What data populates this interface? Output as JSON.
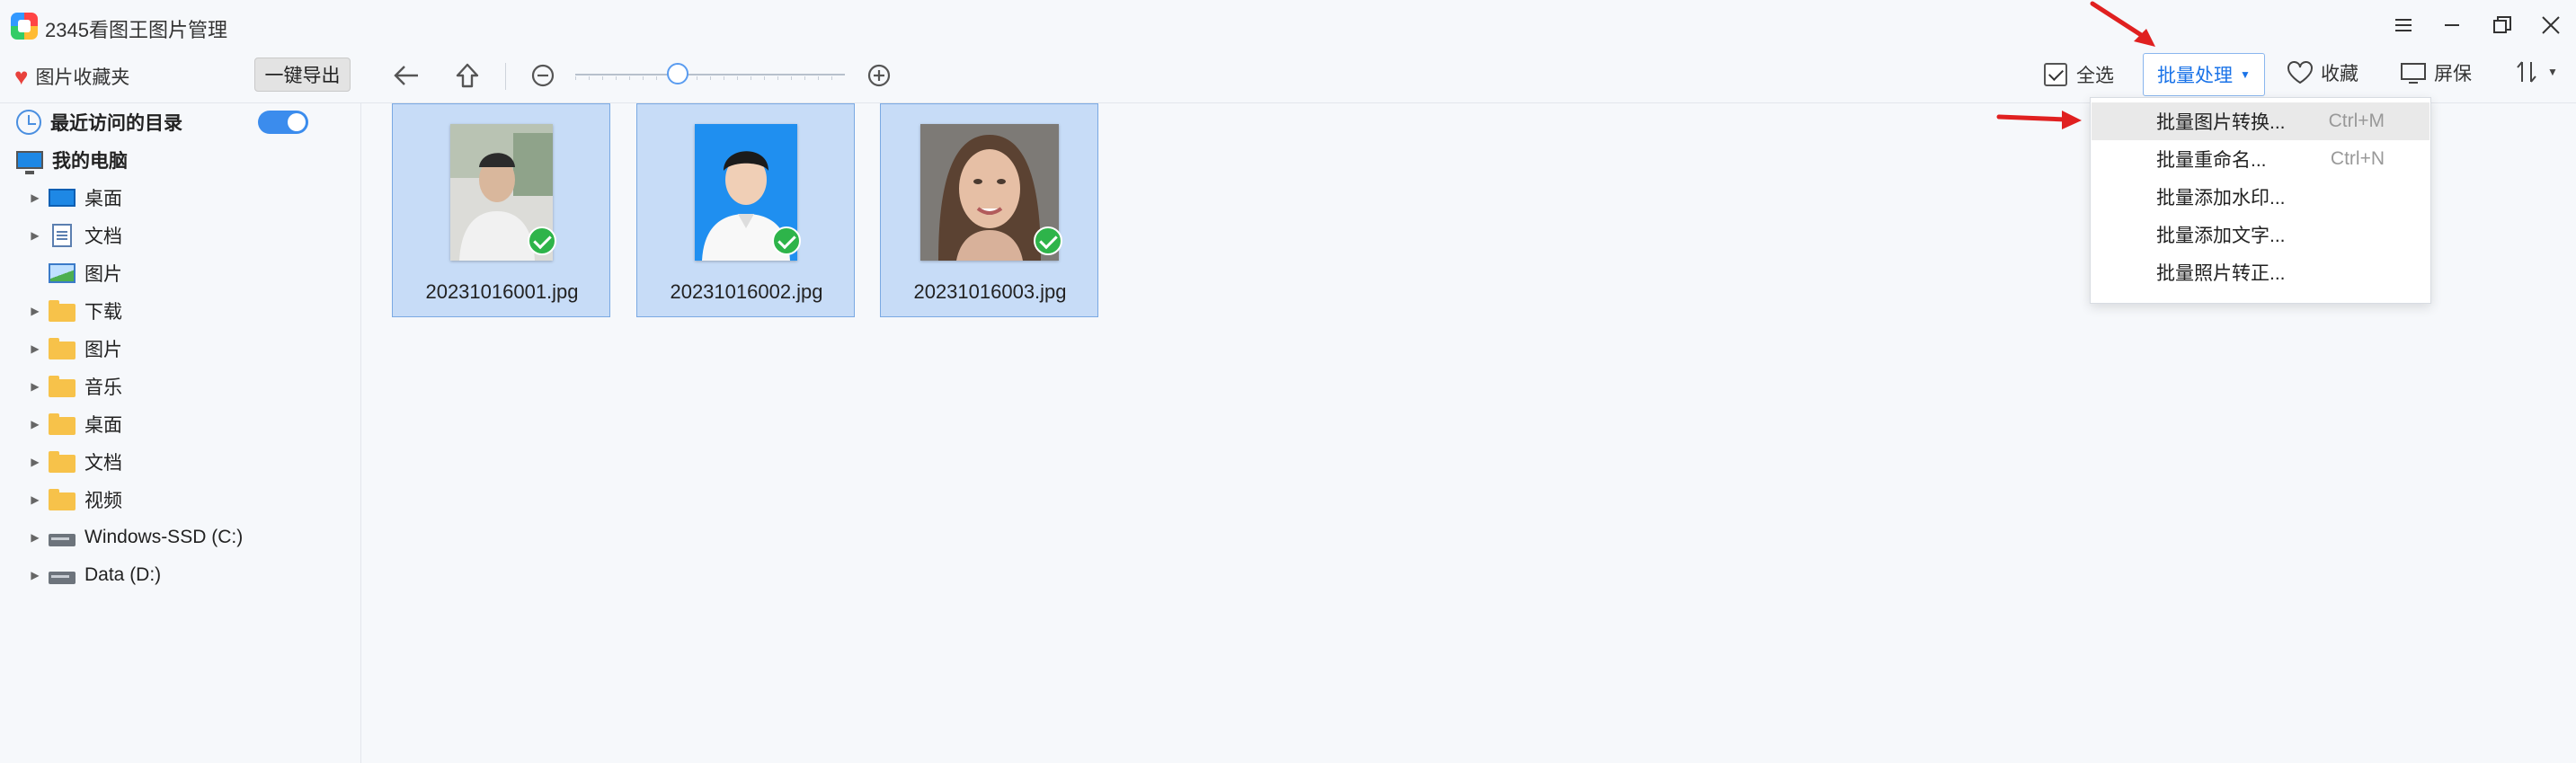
{
  "app": {
    "title": "2345看图王图片管理"
  },
  "window_controls": [
    "menu-icon",
    "minimize-icon",
    "restore-icon",
    "close-icon"
  ],
  "toolbar": {
    "favorites_label": "图片收藏夹",
    "export_label": "一键导出",
    "zoom_level": 0.38,
    "select_all_label": "全选",
    "batch_label": "批量处理",
    "collect_label": "收藏",
    "screensaver_label": "屏保",
    "sort_icon": "sort-icon"
  },
  "sidebar": {
    "recent_label": "最近访问的目录",
    "recent_toggle_on": true,
    "computer_label": "我的电脑",
    "items": [
      {
        "label": "桌面",
        "icon": "desktop-icon",
        "expandable": true
      },
      {
        "label": "文档",
        "icon": "document-icon",
        "expandable": true
      },
      {
        "label": "图片",
        "icon": "picture-icon",
        "expandable": false
      },
      {
        "label": "下载",
        "icon": "folder-icon",
        "expandable": true
      },
      {
        "label": "图片",
        "icon": "folder-icon",
        "expandable": true
      },
      {
        "label": "音乐",
        "icon": "folder-icon",
        "expandable": true
      },
      {
        "label": "桌面",
        "icon": "folder-icon",
        "expandable": true
      },
      {
        "label": "文档",
        "icon": "folder-icon",
        "expandable": true
      },
      {
        "label": "视频",
        "icon": "folder-icon",
        "expandable": true
      },
      {
        "label": "Windows-SSD (C:)",
        "icon": "drive-icon",
        "expandable": true
      },
      {
        "label": "Data (D:)",
        "icon": "drive-icon",
        "expandable": true
      }
    ]
  },
  "files": [
    {
      "name": "20231016001.jpg",
      "selected": true
    },
    {
      "name": "20231016002.jpg",
      "selected": true
    },
    {
      "name": "20231016003.jpg",
      "selected": true
    }
  ],
  "batch_menu": {
    "items": [
      {
        "label": "批量图片转换...",
        "shortcut": "Ctrl+M"
      },
      {
        "label": "批量重命名...",
        "shortcut": "Ctrl+N"
      },
      {
        "label": "批量添加水印...",
        "shortcut": ""
      },
      {
        "label": "批量添加文字...",
        "shortcut": ""
      },
      {
        "label": "批量照片转正...",
        "shortcut": ""
      }
    ]
  },
  "colors": {
    "accent": "#1a73e8",
    "selection": "#c7dcf7",
    "check": "#2eb44a",
    "annotation_arrow": "#e02020"
  }
}
